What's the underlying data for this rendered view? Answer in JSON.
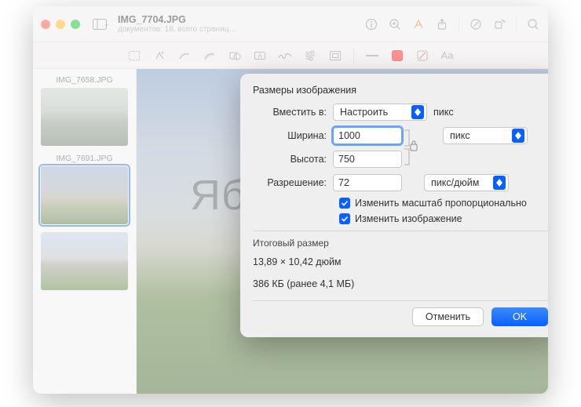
{
  "window": {
    "title": "IMG_7704.JPG",
    "subtitle": "документов: 18, всего страниц…"
  },
  "sidebar": {
    "items": [
      {
        "label": "IMG_7658.JPG"
      },
      {
        "label": "IMG_7691.JPG"
      },
      {
        "label": ""
      }
    ]
  },
  "watermark": "Яблык",
  "dialog": {
    "title": "Размеры изображения",
    "fit_label": "Вместить в:",
    "fit_value": "Настроить",
    "fit_unit_after": "пикс",
    "width_label": "Ширина:",
    "width_value": "1000",
    "height_label": "Высота:",
    "height_value": "750",
    "wh_unit": "пикс",
    "resolution_label": "Разрешение:",
    "resolution_value": "72",
    "resolution_unit": "пикс/дюйм",
    "scale_proportional_label": "Изменить масштаб пропорционально",
    "resample_label": "Изменить изображение",
    "scale_proportional_checked": true,
    "resample_checked": true,
    "result_title": "Итоговый размер",
    "result_dims": "13,89 × 10,42 дюйм",
    "result_size": "386 КБ (ранее 4,1 МБ)",
    "cancel": "Отменить",
    "ok": "OK"
  },
  "toolbar": {
    "markup_label": "Aa"
  },
  "colors": {
    "accent": "#0a60ff"
  }
}
